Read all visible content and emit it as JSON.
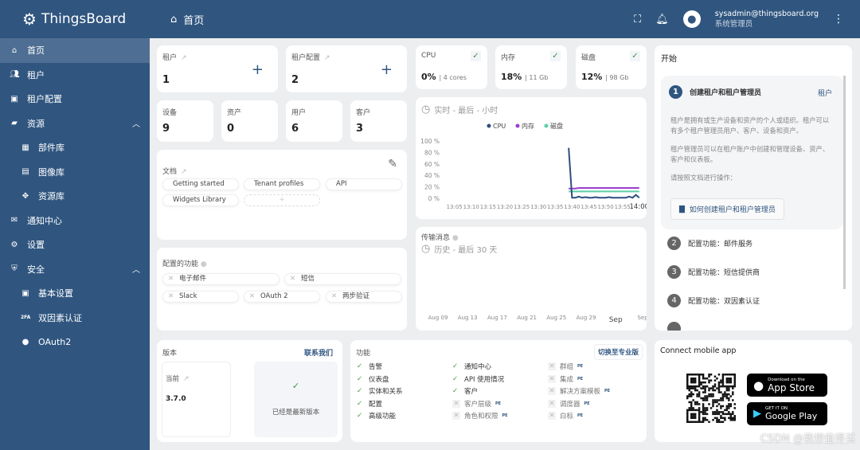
{
  "app": {
    "name": "ThingsBoard"
  },
  "header": {
    "title": "首页",
    "user_email": "sysadmin@thingsboard.org",
    "user_role": "系统管理员"
  },
  "sidebar": {
    "items": [
      {
        "label": "首页",
        "icon": "home-icon",
        "active": true
      },
      {
        "label": "租户",
        "icon": "people-icon"
      },
      {
        "label": "租户配置",
        "icon": "badge-icon"
      },
      {
        "label": "资源",
        "icon": "folder-icon",
        "expanded": true
      },
      {
        "label": "部件库",
        "icon": "widgets-icon",
        "sub": true
      },
      {
        "label": "图像库",
        "icon": "image-icon",
        "sub": true
      },
      {
        "label": "资源库",
        "icon": "resources-icon",
        "sub": true
      },
      {
        "label": "通知中心",
        "icon": "inbox-icon"
      },
      {
        "label": "设置",
        "icon": "gear-icon"
      },
      {
        "label": "安全",
        "icon": "shield-icon",
        "expanded": true
      },
      {
        "label": "基本设置",
        "icon": "security-icon",
        "sub": true
      },
      {
        "label": "双因素认证",
        "icon": "2fa-icon",
        "sub": true
      },
      {
        "label": "OAuth2",
        "icon": "oauth-icon",
        "sub": true
      }
    ]
  },
  "counts": {
    "tenants": {
      "label": "租户",
      "value": "1"
    },
    "tenant_profiles": {
      "label": "租户配置",
      "value": "2"
    },
    "devices": {
      "label": "设备",
      "value": "9"
    },
    "assets": {
      "label": "资产",
      "value": "0"
    },
    "users": {
      "label": "用户",
      "value": "6"
    },
    "customers": {
      "label": "客户",
      "value": "3"
    }
  },
  "docs": {
    "title": "文档",
    "links": [
      "Getting started",
      "Tenant profiles",
      "API",
      "Widgets Library"
    ],
    "add": "+"
  },
  "configured": {
    "title": "配置的功能",
    "items": [
      "电子邮件",
      "短信",
      "Slack",
      "OAuth 2",
      "两步验证"
    ]
  },
  "system": {
    "cpu": {
      "label": "CPU",
      "value": "0%",
      "detail": "| 4 cores"
    },
    "memory": {
      "label": "内存",
      "value": "18%",
      "detail": "| 11 Gb"
    },
    "disk": {
      "label": "磁盘",
      "value": "12%",
      "detail": "| 98 Gb"
    }
  },
  "chart_data": [
    {
      "type": "line",
      "title": "实时 - 最后 - 小时",
      "ylim": [
        0,
        100
      ],
      "yticks": [
        "100 %",
        "80 %",
        "60 %",
        "40 %",
        "20 %",
        "0 %"
      ],
      "xticks": [
        "13:05",
        "13:10",
        "13:15",
        "13:20",
        "13:25",
        "13:30",
        "13:35",
        "13:40",
        "13:45",
        "13:50",
        "13:55",
        "14:00"
      ],
      "x": [
        "13:39",
        "13:40",
        "13:41",
        "13:42",
        "13:43",
        "13:44",
        "13:45",
        "13:46",
        "13:47",
        "13:48",
        "13:49",
        "13:50",
        "13:51",
        "13:52",
        "13:53",
        "13:54",
        "13:55",
        "13:56",
        "13:57",
        "13:58",
        "13:59",
        "14:00"
      ],
      "series": [
        {
          "name": "CPU",
          "color": "#2f4d7e",
          "values": [
            88,
            1,
            1,
            3,
            1,
            2,
            1,
            1,
            2,
            1,
            1,
            1,
            2,
            1,
            1,
            1,
            1,
            1,
            3,
            1,
            6,
            1
          ]
        },
        {
          "name": "内存",
          "color": "#9b3fd0",
          "values": [
            17,
            17,
            17,
            18,
            18,
            18,
            18,
            18,
            18,
            18,
            18,
            18,
            18,
            18,
            18,
            18,
            18,
            18,
            18,
            18,
            18,
            18
          ]
        },
        {
          "name": "磁盘",
          "color": "#5ccfa8",
          "values": [
            12,
            12,
            12,
            12,
            12,
            12,
            12,
            12,
            12,
            12,
            12,
            12,
            12,
            12,
            12,
            12,
            12,
            12,
            12,
            12,
            12,
            12
          ]
        }
      ]
    },
    {
      "type": "line",
      "title": "传输消息",
      "subtitle": "历史 - 最后 30 天",
      "xticks": [
        "Aug 09",
        "Aug 13",
        "Aug 17",
        "Aug 21",
        "Aug 25",
        "Aug 29",
        "Sep",
        "Sep 0"
      ],
      "series": []
    }
  ],
  "start": {
    "title": "开始",
    "tab": "租户",
    "steps": [
      {
        "n": "1",
        "label": "创建租户和租户管理员"
      },
      {
        "n": "2",
        "label": "配置功能：邮件服务"
      },
      {
        "n": "3",
        "label": "配置功能：短信提供商"
      },
      {
        "n": "4",
        "label": "配置功能：双因素认证"
      }
    ],
    "p1": "租户是拥有或生产设备和资产的个人或组织。租户可以有多个租户管理员用户、客户、设备和资产。",
    "p2": "租户管理员可以在租户账户中创建和管理设备、资产、客户和仪表板。",
    "p3": "请按照文档进行操作：",
    "doc_button": "如何创建租户和租户管理员"
  },
  "version": {
    "title": "版本",
    "contact": "联系我们",
    "current_label": "当前",
    "current": "3.7.0",
    "status": "已经是最新版本"
  },
  "features": {
    "title": "功能",
    "switch": "切换至专业版",
    "pe": "PE",
    "items": [
      {
        "label": "告警",
        "on": true
      },
      {
        "label": "通知中心",
        "on": true
      },
      {
        "label": "群组",
        "on": false
      },
      {
        "label": "仪表盘",
        "on": true
      },
      {
        "label": "API 使用情况",
        "on": true
      },
      {
        "label": "集成",
        "on": false
      },
      {
        "label": "实体和关系",
        "on": true
      },
      {
        "label": "客户",
        "on": true
      },
      {
        "label": "解决方案模板",
        "on": false
      },
      {
        "label": "配置",
        "on": true
      },
      {
        "label": "客户层级",
        "on": false
      },
      {
        "label": "调度器",
        "on": false
      },
      {
        "label": "高级功能",
        "on": true
      },
      {
        "label": "角色和权限",
        "on": false
      },
      {
        "label": "白标",
        "on": false
      }
    ]
  },
  "mobile": {
    "title": "Connect mobile app",
    "appstore_small": "Download on the",
    "appstore": "App Store",
    "gplay_small": "GET IT ON",
    "gplay": "Google Play"
  },
  "watermark": "CSDN @我想值得买"
}
